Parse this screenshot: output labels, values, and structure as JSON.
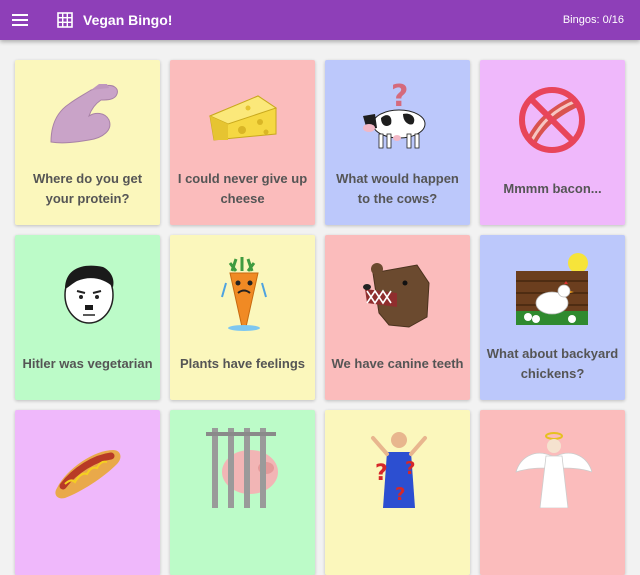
{
  "app": {
    "title": "Vegan Bingo!",
    "bingo_count": "Bingos: 0/16",
    "menu_icon": "menu-icon",
    "logo_icon": "grid-icon",
    "bar_color": "#8e3fb8"
  },
  "cards": [
    {
      "label": "Where do you get your protein?",
      "icon": "flexed-arm-icon",
      "color": "#fbf7bc"
    },
    {
      "label": "I could never give up cheese",
      "icon": "cheese-icon",
      "color": "#fbbcbc"
    },
    {
      "label": "What would happen to the cows?",
      "icon": "cow-icon",
      "color": "#bcc8fb"
    },
    {
      "label": "Mmmm bacon...",
      "icon": "no-bacon-icon",
      "color": "#efb8fb"
    },
    {
      "label": "Hitler was vegetarian",
      "icon": "hitler-face-icon",
      "color": "#bcfbc8"
    },
    {
      "label": "Plants have feelings",
      "icon": "crying-carrot-icon",
      "color": "#fbf7bc"
    },
    {
      "label": "We have canine teeth",
      "icon": "bear-head-icon",
      "color": "#fbbcbc"
    },
    {
      "label": "What about backyard chickens?",
      "icon": "chickens-icon",
      "color": "#bcc8fb"
    },
    {
      "label": "",
      "icon": "hotdog-icon",
      "color": "#efb8fb"
    },
    {
      "label": "",
      "icon": "caged-pig-icon",
      "color": "#bcfbc8"
    },
    {
      "label": "",
      "icon": "question-woman-icon",
      "color": "#fbf7bc"
    },
    {
      "label": "",
      "icon": "angel-icon",
      "color": "#fbbcbc"
    }
  ]
}
